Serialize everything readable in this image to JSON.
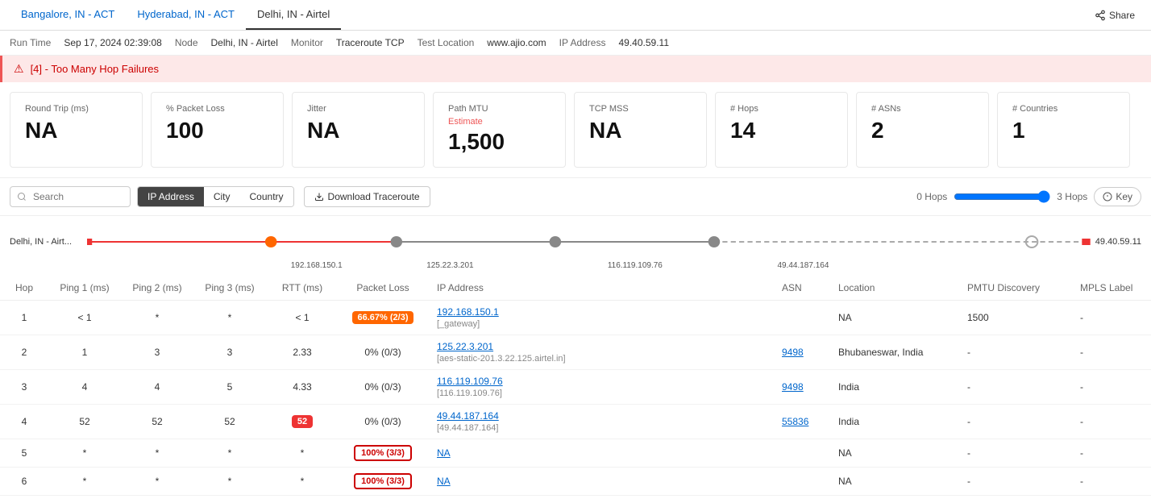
{
  "tabs": [
    {
      "label": "Bangalore, IN - ACT",
      "active": false
    },
    {
      "label": "Hyderabad, IN - ACT",
      "active": false
    },
    {
      "label": "Delhi, IN - Airtel",
      "active": true
    }
  ],
  "runInfo": {
    "runTimeLabel": "Run Time",
    "runTimeValue": "Sep 17, 2024 02:39:08",
    "nodeLabel": "Node",
    "nodeValue": "Delhi, IN - Airtel",
    "monitorLabel": "Monitor",
    "monitorValue": "Traceroute TCP",
    "testLocationLabel": "Test Location",
    "testLocationValue": "www.ajio.com",
    "ipLabel": "IP Address",
    "ipValue": "49.40.59.11"
  },
  "alert": {
    "icon": "⚠",
    "text": "[4] - Too Many Hop Failures"
  },
  "metrics": [
    {
      "label": "Round Trip (ms)",
      "value": "NA",
      "sublabel": ""
    },
    {
      "label": "% Packet Loss",
      "value": "100",
      "sublabel": ""
    },
    {
      "label": "Jitter",
      "value": "NA",
      "sublabel": ""
    },
    {
      "label": "Path MTU",
      "value": "1,500",
      "sublabel": "Estimate"
    },
    {
      "label": "TCP MSS",
      "value": "NA",
      "sublabel": ""
    },
    {
      "label": "# Hops",
      "value": "14",
      "sublabel": ""
    },
    {
      "label": "# ASNs",
      "value": "2",
      "sublabel": ""
    },
    {
      "label": "# Countries",
      "value": "1",
      "sublabel": ""
    }
  ],
  "toolbar": {
    "searchPlaceholder": "Search",
    "filterButtons": [
      {
        "label": "IP Address",
        "active": true
      },
      {
        "label": "City",
        "active": false
      },
      {
        "label": "Country",
        "active": false
      }
    ],
    "downloadLabel": "Download Traceroute",
    "hopsLeft": "0 Hops",
    "hopsRight": "3 Hops",
    "keyLabel": "Key"
  },
  "traceroute": {
    "sourceLabel": "Delhi, IN - Airt...",
    "destLabel": "49.40.59.11",
    "waypoints": [
      {
        "label": "192.168.150.1",
        "x": 18,
        "color": "#f60"
      },
      {
        "label": "125.22.3.201",
        "x": 32,
        "color": "#888"
      },
      {
        "label": "116.119.109.76",
        "x": 47,
        "color": "#888"
      },
      {
        "label": "49.44.187.164",
        "x": 62,
        "color": "#888"
      }
    ]
  },
  "tableHeaders": [
    "Hop",
    "Ping 1 (ms)",
    "Ping 2 (ms)",
    "Ping 3 (ms)",
    "RTT (ms)",
    "Packet Loss",
    "IP Address",
    "ASN",
    "Location",
    "PMTU Discovery",
    "MPLS Label"
  ],
  "tableRows": [
    {
      "hop": "1",
      "ping1": "< 1",
      "ping2": "*",
      "ping3": "*",
      "rtt": "< 1",
      "packetLoss": {
        "text": "66.67% (2/3)",
        "type": "orange"
      },
      "ip": "192.168.150.1",
      "ipSub": "[_gateway]",
      "asn": "",
      "location": "NA",
      "pmtu": "1500",
      "mpls": "-"
    },
    {
      "hop": "2",
      "ping1": "1",
      "ping2": "3",
      "ping3": "3",
      "rtt": "2.33",
      "packetLoss": {
        "text": "0% (0/3)",
        "type": "none"
      },
      "ip": "125.22.3.201",
      "ipSub": "[aes-static-201.3.22.125.airtel.in]",
      "asn": "9498",
      "location": "Bhubaneswar, India",
      "pmtu": "-",
      "mpls": "-"
    },
    {
      "hop": "3",
      "ping1": "4",
      "ping2": "4",
      "ping3": "5",
      "rtt": "4.33",
      "packetLoss": {
        "text": "0% (0/3)",
        "type": "none"
      },
      "ip": "116.119.109.76",
      "ipSub": "[116.119.109.76]",
      "asn": "9498",
      "location": "India",
      "pmtu": "-",
      "mpls": "-"
    },
    {
      "hop": "4",
      "ping1": "52",
      "ping2": "52",
      "ping3": "52",
      "rtt": "52",
      "packetLoss": {
        "text": "0% (0/3)",
        "type": "none"
      },
      "ip": "49.44.187.164",
      "ipSub": "[49.44.187.164]",
      "asn": "55836",
      "location": "India",
      "pmtu": "-",
      "mpls": "-"
    },
    {
      "hop": "5",
      "ping1": "*",
      "ping2": "*",
      "ping3": "*",
      "rtt": "*",
      "packetLoss": {
        "text": "100% (3/3)",
        "type": "red-outline"
      },
      "ip": "NA",
      "ipSub": "",
      "asn": "",
      "location": "NA",
      "pmtu": "-",
      "mpls": "-"
    },
    {
      "hop": "6",
      "ping1": "*",
      "ping2": "*",
      "ping3": "*",
      "rtt": "*",
      "packetLoss": {
        "text": "100% (3/3)",
        "type": "red-outline"
      },
      "ip": "NA",
      "ipSub": "",
      "asn": "",
      "location": "NA",
      "pmtu": "-",
      "mpls": "-"
    }
  ]
}
